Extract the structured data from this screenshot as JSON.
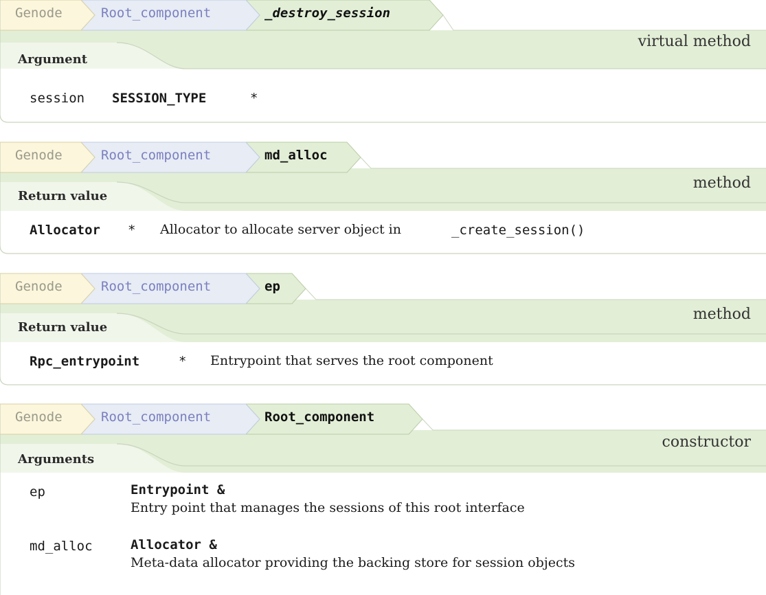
{
  "blocks": [
    {
      "breadcrumb": [
        "Genode",
        "Root_component",
        "_destroy_session"
      ],
      "kind": "virtual method",
      "section": "Argument",
      "rows": [
        {
          "name": "session",
          "type": "SESSION_TYPE",
          "suffix": "*"
        }
      ]
    },
    {
      "breadcrumb": [
        "Genode",
        "Root_component",
        "md_alloc"
      ],
      "kind": "method",
      "section": "Return value",
      "return": {
        "type": "Allocator",
        "suffix": "*",
        "desc": "Allocator to allocate server object in",
        "code": "_create_session()"
      }
    },
    {
      "breadcrumb": [
        "Genode",
        "Root_component",
        "ep"
      ],
      "kind": "method",
      "section": "Return value",
      "return": {
        "type": "Rpc_entrypoint",
        "suffix": "*",
        "desc": "Entrypoint that serves the root component"
      }
    },
    {
      "breadcrumb": [
        "Genode",
        "Root_component",
        "Root_component"
      ],
      "kind": "constructor",
      "section": "Arguments",
      "rows": [
        {
          "name": "ep",
          "type": "Entrypoint &",
          "desc": "Entry point that manages the sessions of this root interface"
        },
        {
          "name": "md_alloc",
          "type": "Allocator &",
          "desc": "Meta-data allocator providing the backing store for session objects"
        }
      ]
    }
  ],
  "colors": {
    "ns_tab": "#fbf6dc",
    "class_tab": "#e7ecf5",
    "current_tab": "#e2eed6",
    "header_band": "#e2eed6",
    "border": "#c9d4bd"
  }
}
